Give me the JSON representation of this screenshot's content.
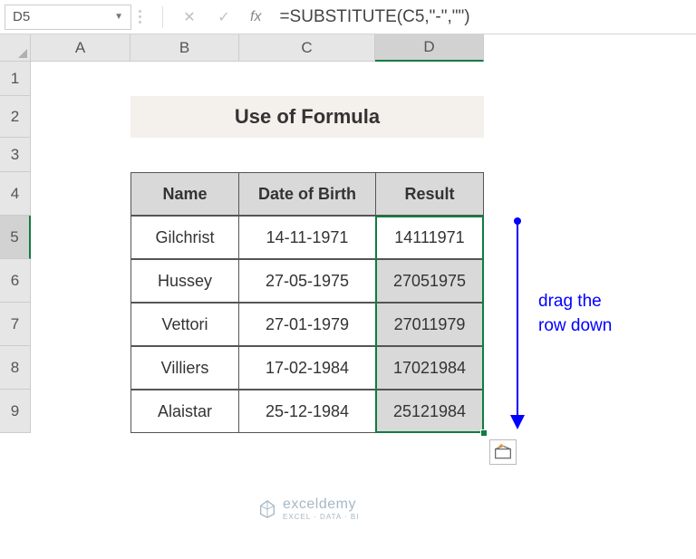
{
  "nameBox": "D5",
  "formula": "=SUBSTITUTE(C5,\"-\",\"\")",
  "columns": [
    "A",
    "B",
    "C",
    "D"
  ],
  "rows": [
    "1",
    "2",
    "3",
    "4",
    "5",
    "6",
    "7",
    "8",
    "9"
  ],
  "title": "Use of Formula",
  "headers": {
    "name": "Name",
    "dob": "Date of Birth",
    "result": "Result"
  },
  "data": [
    {
      "name": "Gilchrist",
      "dob": "14-11-1971",
      "result": "14111971"
    },
    {
      "name": "Hussey",
      "dob": "27-05-1975",
      "result": "27051975"
    },
    {
      "name": "Vettori",
      "dob": "27-01-1979",
      "result": "27011979"
    },
    {
      "name": "Villiers",
      "dob": "17-02-1984",
      "result": "17021984"
    },
    {
      "name": "Alaistar",
      "dob": "25-12-1984",
      "result": "25121984"
    }
  ],
  "annotation": {
    "line1": "drag the",
    "line2": "row down"
  },
  "watermark": {
    "title": "exceldemy",
    "sub": "EXCEL · DATA · BI"
  },
  "chart_data": {
    "type": "table",
    "title": "Use of Formula",
    "columns": [
      "Name",
      "Date of Birth",
      "Result"
    ],
    "rows": [
      [
        "Gilchrist",
        "14-11-1971",
        "14111971"
      ],
      [
        "Hussey",
        "27-05-1975",
        "27051975"
      ],
      [
        "Vettori",
        "27-01-1979",
        "27011979"
      ],
      [
        "Villiers",
        "17-02-1984",
        "17021984"
      ],
      [
        "Alaistar",
        "25-12-1984",
        "25121984"
      ]
    ]
  },
  "colWidths": {
    "A": 110,
    "B": 120,
    "C": 150,
    "D": 120
  },
  "rowHeights": {
    "1": 38,
    "2": 46,
    "3": 38,
    "4": 48,
    "5": 48,
    "6": 48,
    "7": 48,
    "8": 48,
    "9": 48
  }
}
